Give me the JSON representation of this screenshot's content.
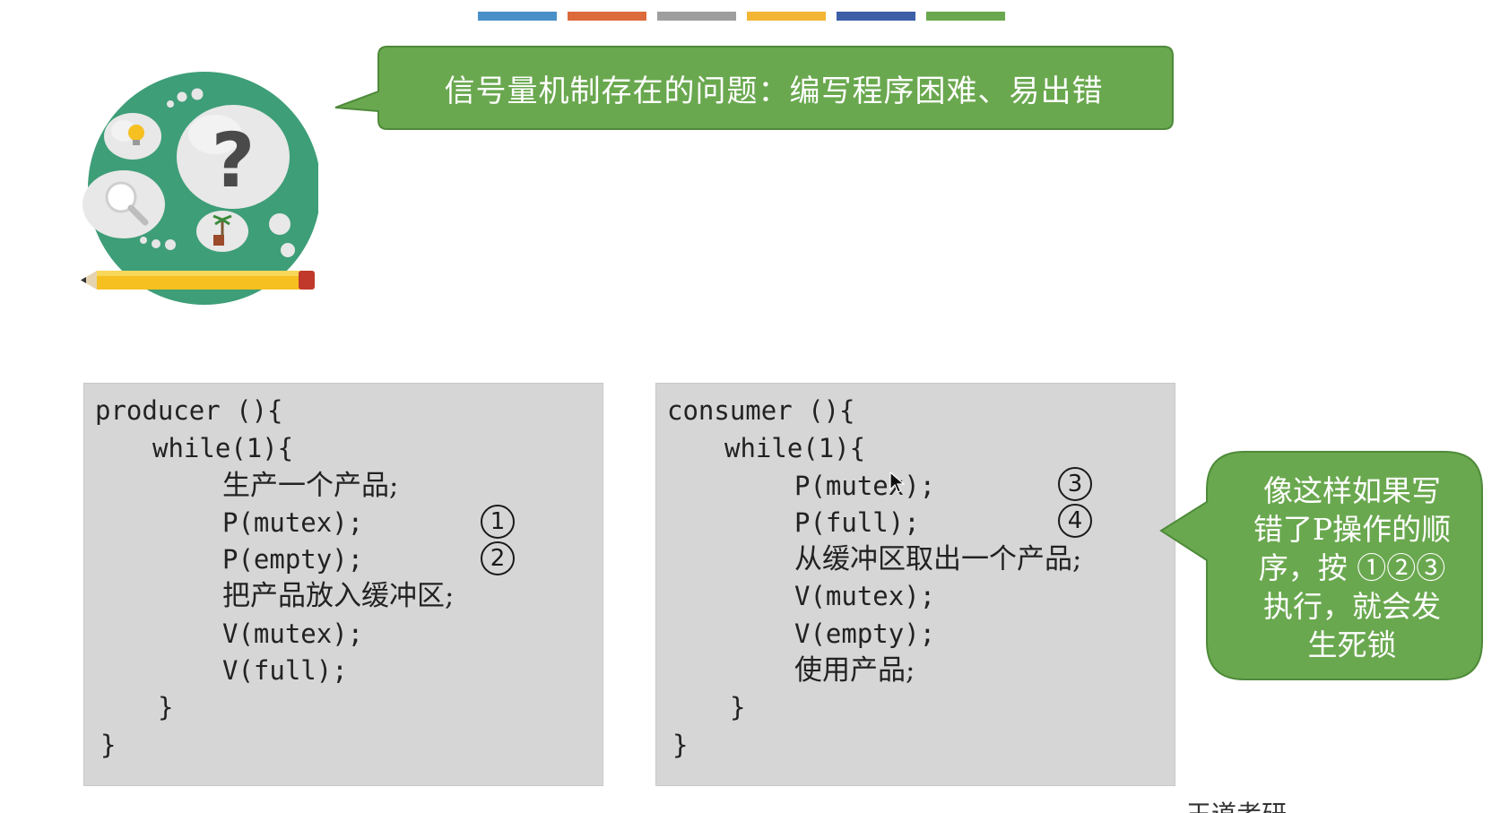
{
  "header": {
    "color_strip": [
      "#4a90c8",
      "#dd6a3a",
      "#9e9e9e",
      "#f3b534",
      "#3c5fa8",
      "#6aa84f"
    ]
  },
  "illustration": {
    "icon": "thinking-head-question-icon",
    "colors": {
      "circle": "#3e9e78",
      "pencil": "#f5c020"
    }
  },
  "top_callout": {
    "text": "信号量机制存在的问题：编写程序困难、易出错",
    "color": "#6aa84f"
  },
  "producer": {
    "lines": [
      "producer (){",
      "while(1){",
      "生产一个产品;",
      "P(mutex);",
      "P(empty);",
      "把产品放入缓冲区;",
      "V(mutex);",
      "V(full);",
      "}",
      "}"
    ],
    "markers": [
      "1",
      "2"
    ]
  },
  "consumer": {
    "lines": [
      "consumer (){",
      "while(1){",
      "P(mutex);",
      "P(full);",
      "从缓冲区取出一个产品;",
      "V(mutex);",
      "V(empty);",
      "使用产品;",
      "}",
      "}"
    ],
    "markers": [
      "3",
      "4"
    ]
  },
  "side_callout": {
    "lines": [
      "像这样如果写",
      "错了P操作的顺",
      "序，按 ①②③",
      "执行，就会发",
      "生死锁"
    ],
    "color": "#6aa84f"
  },
  "footer": {
    "fragment": "王道考研"
  }
}
